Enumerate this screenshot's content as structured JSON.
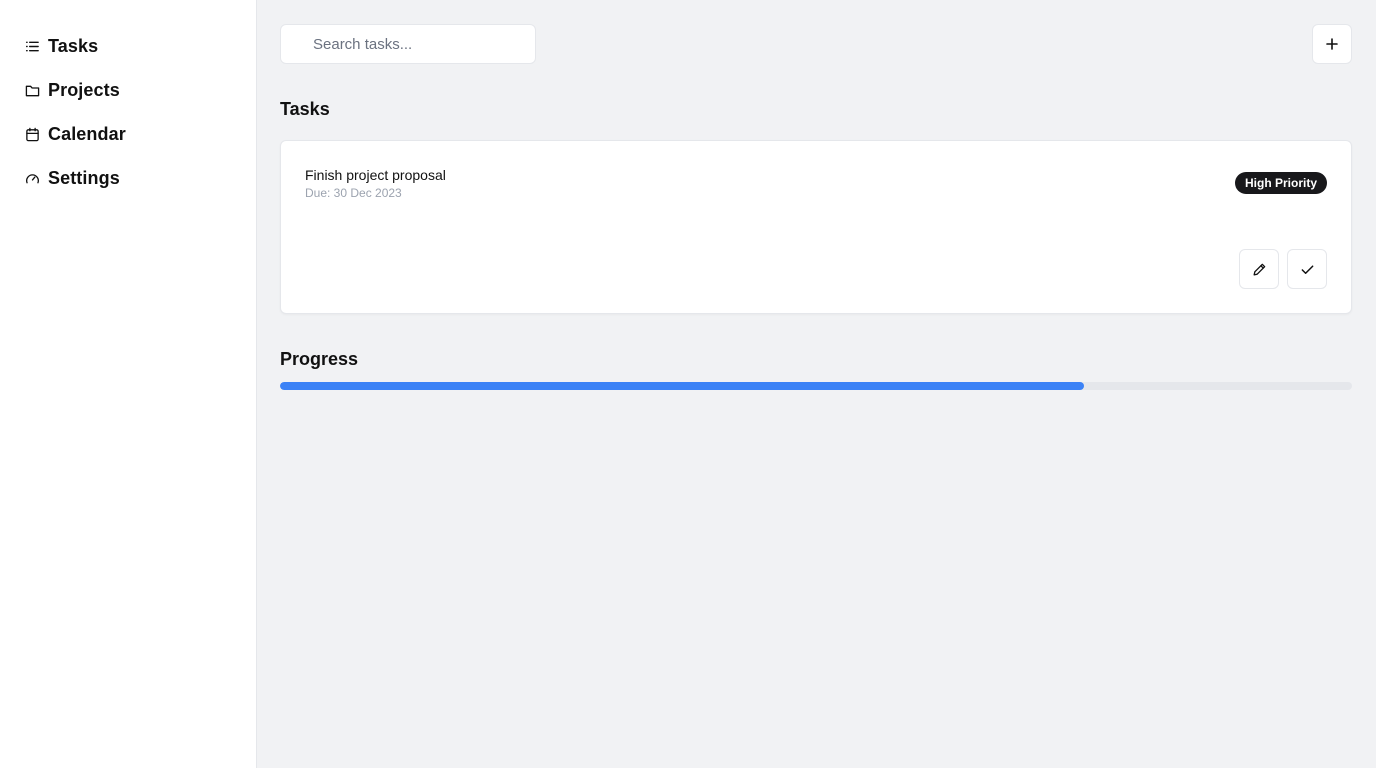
{
  "sidebar": {
    "items": [
      {
        "label": "Tasks",
        "icon": "list-icon"
      },
      {
        "label": "Projects",
        "icon": "folder-icon"
      },
      {
        "label": "Calendar",
        "icon": "calendar-icon"
      },
      {
        "label": "Settings",
        "icon": "gauge-icon"
      }
    ]
  },
  "search": {
    "placeholder": "Search tasks...",
    "value": ""
  },
  "toolbar": {
    "add_label": "+"
  },
  "tasks_section": {
    "title": "Tasks",
    "items": [
      {
        "name": "Finish project proposal",
        "due": "Due: 30 Dec 2023",
        "priority": "High Priority"
      }
    ]
  },
  "progress_section": {
    "title": "Progress",
    "percent": 75
  },
  "colors": {
    "accent": "#3b82f6",
    "badge_bg": "#18181b",
    "page_bg": "#f1f2f4",
    "muted_text": "#9ca3af"
  }
}
